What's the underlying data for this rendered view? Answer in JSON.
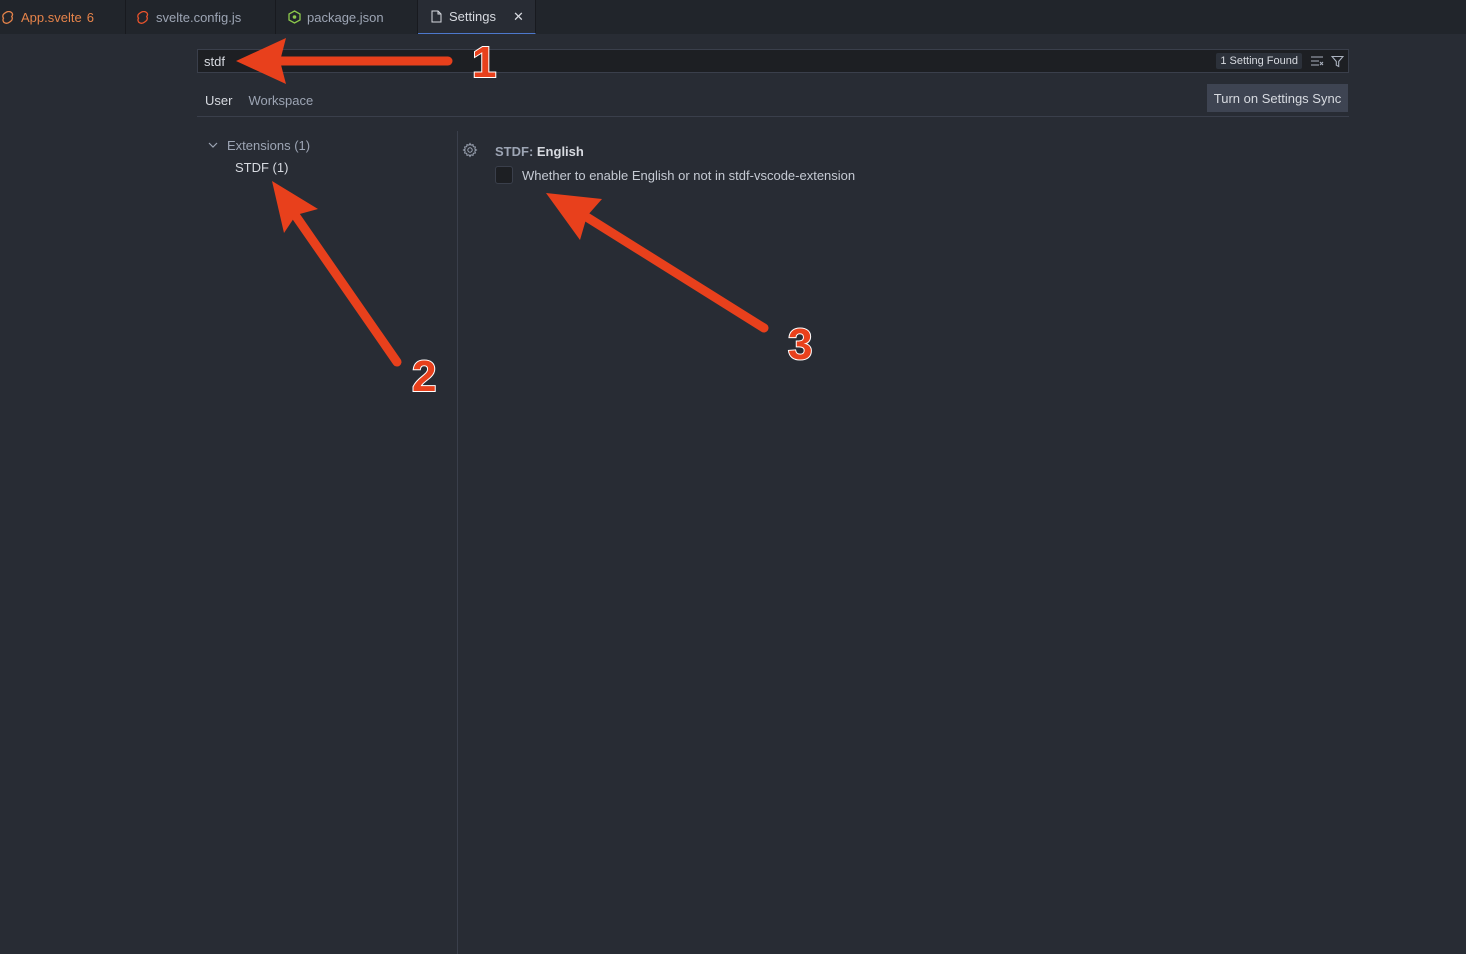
{
  "tabs": [
    {
      "label": "App.svelte",
      "badge": "6"
    },
    {
      "label": "svelte.config.js"
    },
    {
      "label": "package.json"
    },
    {
      "label": "Settings",
      "close": "✕"
    }
  ],
  "search": {
    "value": "stdf",
    "result_count": "1 Setting Found"
  },
  "scopes": {
    "user": "User",
    "workspace": "Workspace"
  },
  "sync_button": "Turn on Settings Sync",
  "toc": {
    "extensions": "Extensions (1)",
    "stdf": "STDF (1)"
  },
  "setting": {
    "category": "STDF: ",
    "name": "English",
    "description": "Whether to enable English or not in stdf-vscode-extension",
    "checked": false
  },
  "annotations": {
    "one": "1",
    "two": "2",
    "three": "3"
  },
  "colors": {
    "background": "#282c34",
    "tabbar": "#21252b",
    "svelte_orange": "#e5834a",
    "annotation_red": "#e8401c"
  }
}
